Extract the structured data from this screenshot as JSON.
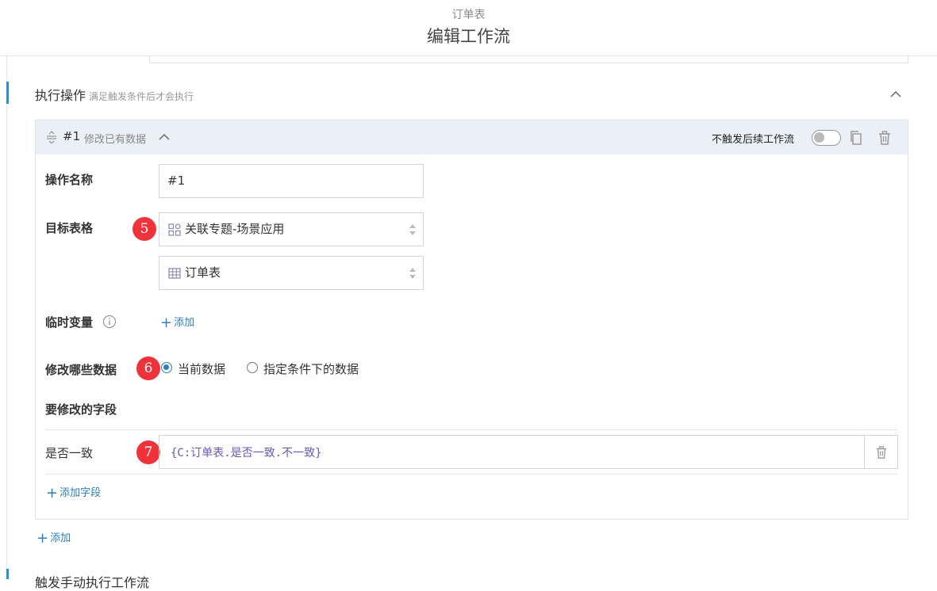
{
  "header": {
    "subtitle": "订单表",
    "title": "编辑工作流"
  },
  "section": {
    "title": "执行操作",
    "hint": "满足触发条件后才会执行"
  },
  "operation": {
    "number": "#1",
    "type": "修改已有数据",
    "no_trigger_label": "不触发后续工作流",
    "no_trigger_enabled": false
  },
  "form": {
    "name_label": "操作名称",
    "name_value": "#1",
    "target_label": "目标表格",
    "target_app": "关联专题-场景应用",
    "target_table": "订单表",
    "temp_var_label": "临时变量",
    "add_label": "添加",
    "modify_label": "修改哪些数据",
    "radio_current": "当前数据",
    "radio_condition": "指定条件下的数据",
    "fields_label": "要修改的字段",
    "field_name": "是否一致",
    "field_expr": "{C:订单表.是否一致.不一致}",
    "add_field_label": "添加字段"
  },
  "badges": [
    "5",
    "6",
    "7"
  ],
  "footer": {
    "add_label": "添加",
    "next_section": "触发手动执行工作流"
  },
  "colors": {
    "accent": "#2c8ed4",
    "badge": "#f0333a",
    "link": "#2c7fc2",
    "expr": "#6a56b8"
  }
}
